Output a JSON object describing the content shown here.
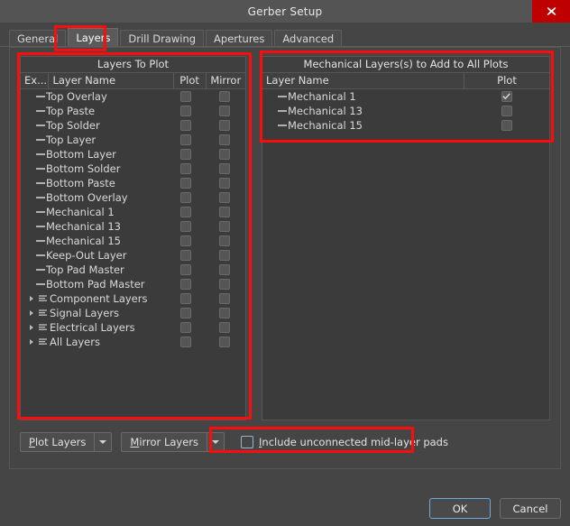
{
  "window": {
    "title": "Gerber Setup",
    "close_icon": "close-x-icon"
  },
  "tabs": [
    {
      "label": "General",
      "active": false
    },
    {
      "label": "Layers",
      "active": true
    },
    {
      "label": "Drill Drawing",
      "active": false
    },
    {
      "label": "Apertures",
      "active": false
    },
    {
      "label": "Advanced",
      "active": false
    }
  ],
  "left_panel": {
    "title": "Layers To Plot",
    "columns": [
      "Ex...",
      "Layer Name",
      "Plot",
      "Mirror"
    ],
    "rows": [
      {
        "name": "Top Overlay",
        "type": "layer",
        "plot": false,
        "mirror": false
      },
      {
        "name": "Top Paste",
        "type": "layer",
        "plot": false,
        "mirror": false
      },
      {
        "name": "Top Solder",
        "type": "layer",
        "plot": false,
        "mirror": false
      },
      {
        "name": "Top Layer",
        "type": "layer",
        "plot": false,
        "mirror": false
      },
      {
        "name": "Bottom Layer",
        "type": "layer",
        "plot": false,
        "mirror": false
      },
      {
        "name": "Bottom Solder",
        "type": "layer",
        "plot": false,
        "mirror": false
      },
      {
        "name": "Bottom Paste",
        "type": "layer",
        "plot": false,
        "mirror": false
      },
      {
        "name": "Bottom Overlay",
        "type": "layer",
        "plot": false,
        "mirror": false
      },
      {
        "name": "Mechanical 1",
        "type": "layer",
        "plot": false,
        "mirror": false
      },
      {
        "name": "Mechanical 13",
        "type": "layer",
        "plot": false,
        "mirror": false
      },
      {
        "name": "Mechanical 15",
        "type": "layer",
        "plot": false,
        "mirror": false
      },
      {
        "name": "Keep-Out Layer",
        "type": "layer",
        "plot": false,
        "mirror": false
      },
      {
        "name": "Top Pad Master",
        "type": "layer",
        "plot": false,
        "mirror": false
      },
      {
        "name": "Bottom Pad Master",
        "type": "layer",
        "plot": false,
        "mirror": false
      },
      {
        "name": "Component Layers",
        "type": "group",
        "plot": false,
        "mirror": false
      },
      {
        "name": "Signal Layers",
        "type": "group",
        "plot": false,
        "mirror": false
      },
      {
        "name": "Electrical Layers",
        "type": "group",
        "plot": false,
        "mirror": false
      },
      {
        "name": "All Layers",
        "type": "group",
        "plot": false,
        "mirror": false
      }
    ]
  },
  "right_panel": {
    "title": "Mechanical Layers(s) to Add to All Plots",
    "columns": [
      "Layer Name",
      "Plot"
    ],
    "rows": [
      {
        "name": "Mechanical 1",
        "type": "layer",
        "plot": true
      },
      {
        "name": "Mechanical 13",
        "type": "layer",
        "plot": false
      },
      {
        "name": "Mechanical 15",
        "type": "layer",
        "plot": false
      }
    ]
  },
  "bottom": {
    "plot_layers": {
      "accel": "P",
      "rest": "lot Layers"
    },
    "mirror_layers": {
      "accel": "M",
      "rest": "irror Layers"
    },
    "include_checkbox": {
      "accel": "I",
      "rest": "nclude unconnected mid-layer pads",
      "checked": false
    }
  },
  "dialog_buttons": {
    "ok": "OK",
    "cancel": "Cancel"
  },
  "colors": {
    "window_bg": "#454545",
    "titlebar": "#545454",
    "panel_bg": "#3b3b3b",
    "close_red": "#bf0000",
    "highlight_red": "#fb0d0d",
    "focus_blue": "#6fa8dc"
  }
}
